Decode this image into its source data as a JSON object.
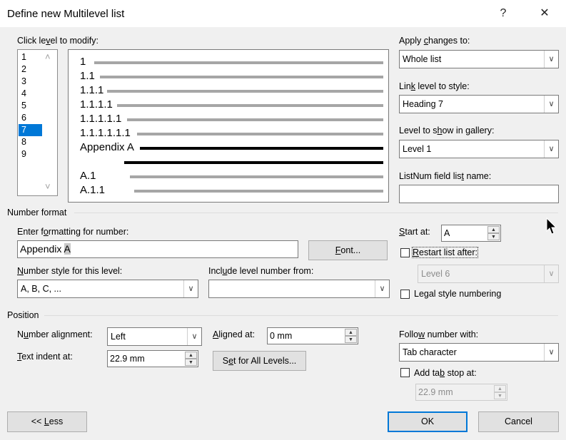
{
  "window": {
    "title": "Define new Multilevel list",
    "help_glyph": "?",
    "close_glyph": "✕"
  },
  "levels": {
    "label_pre": "Click le",
    "label_key": "v",
    "label_post": "el to modify:",
    "items": [
      "1",
      "2",
      "3",
      "4",
      "5",
      "6",
      "7",
      "8",
      "9"
    ],
    "selected": "7"
  },
  "preview": {
    "lines": [
      "1",
      "1.1",
      "1.1.1",
      "1.1.1.1",
      "1.1.1.1.1",
      "1.1.1.1.1.1",
      "Appendix A",
      "A.1",
      "A.1.1"
    ]
  },
  "apply_changes": {
    "label_pre": "Apply ",
    "label_key": "c",
    "label_post": "hanges to:",
    "value": "Whole list"
  },
  "link_style": {
    "label_pre": "Lin",
    "label_key": "k",
    "label_post": " level to style:",
    "value": "Heading 7"
  },
  "gallery": {
    "label_pre": "Level to s",
    "label_key": "h",
    "label_post": "ow in gallery:",
    "value": "Level 1"
  },
  "listnum": {
    "label_pre": "ListNum field lis",
    "label_key": "t",
    "label_post": " name:",
    "value": ""
  },
  "number_format": {
    "section": "Number format",
    "enter_label_pre": "Enter f",
    "enter_label_key": "o",
    "enter_label_post": "rmatting for number:",
    "format_prefix": "Appendix ",
    "format_highlight": "A",
    "font_button_key": "F",
    "font_button_post": "ont...",
    "style_label_key": "N",
    "style_label_post": "umber style for this level:",
    "style_value": "A, B, C, ...",
    "include_label_pre": "Incl",
    "include_label_key": "u",
    "include_label_post": "de level number from:",
    "include_value": "",
    "start_label_key": "S",
    "start_label_post": "tart at:",
    "start_value": "A",
    "restart_label_key": "R",
    "restart_label_post": "estart list after:",
    "restart_value": "Level 6",
    "legal_label_pre": "Le",
    "legal_label_key": "g",
    "legal_label_post": "al style numbering"
  },
  "position": {
    "section": "Position",
    "align_label_pre": "N",
    "align_label_key": "u",
    "align_label_post": "mber alignment:",
    "align_value": "Left",
    "aligned_at_label_pre": "",
    "aligned_at_label_key": "A",
    "aligned_at_label_post": "ligned at:",
    "aligned_at_value": "0 mm",
    "indent_label_pre": "",
    "indent_label_key": "T",
    "indent_label_post": "ext indent at:",
    "indent_value": "22.9 mm",
    "set_all_pre": "S",
    "set_all_key": "e",
    "set_all_post": "t for All Levels...",
    "follow_label_pre": "Follo",
    "follow_label_key": "w",
    "follow_label_post": " number with:",
    "follow_value": "Tab character",
    "tabstop_label_pre": "Add ta",
    "tabstop_label_key": "b",
    "tabstop_label_post": " stop at:",
    "tabstop_value": "22.9 mm"
  },
  "buttons": {
    "less_pre": "<< ",
    "less_key": "L",
    "less_post": "ess",
    "ok": "OK",
    "cancel": "Cancel"
  },
  "icons": {
    "spin_up": "▲",
    "spin_down": "▼",
    "dropdown": "∨",
    "scroll_up": "˄",
    "scroll_down": "˅"
  }
}
